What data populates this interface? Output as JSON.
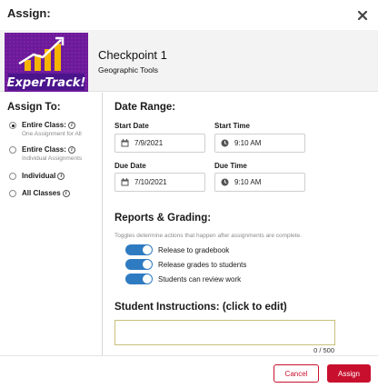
{
  "modal": {
    "title": "Assign:"
  },
  "assignment": {
    "name": "Checkpoint 1",
    "subtitle": "Geographic Tools",
    "thumbnail_text": "ExperTrack!"
  },
  "assign_to": {
    "heading": "Assign To:",
    "options": [
      {
        "label": "Entire Class:",
        "sub": "One Assignment for All",
        "checked": true,
        "icon": "info-icon"
      },
      {
        "label": "Entire Class:",
        "sub": "Individual Assignments",
        "checked": false,
        "icon": "info-icon"
      },
      {
        "label": "Individual",
        "sub": "",
        "checked": false,
        "icon": "info-icon"
      },
      {
        "label": "All Classes",
        "sub": "",
        "checked": false,
        "icon": "info-icon"
      }
    ]
  },
  "date_range": {
    "heading": "Date Range:",
    "start_date_label": "Start Date",
    "start_date": "7/9/2021",
    "start_time_label": "Start Time",
    "start_time": "9:10 AM",
    "due_date_label": "Due Date",
    "due_date": "7/10/2021",
    "due_time_label": "Due Time",
    "due_time": "9:10 AM"
  },
  "reports": {
    "heading": "Reports & Grading:",
    "hint": "Toggles determine actions that happen after assignments are complete.",
    "toggles": [
      {
        "label": "Release to gradebook",
        "on": true
      },
      {
        "label": "Release grades to students",
        "on": true
      },
      {
        "label": "Students can review work",
        "on": true
      }
    ]
  },
  "instructions": {
    "heading": "Student Instructions: (click to edit)",
    "value": "",
    "char_count": "0 / 500"
  },
  "footer": {
    "cancel_label": "Cancel",
    "assign_label": "Assign"
  },
  "colors": {
    "accent_red": "#c8102e",
    "toggle_blue": "#2f7bc2",
    "thumbnail_purple": "#7b1fa2"
  }
}
